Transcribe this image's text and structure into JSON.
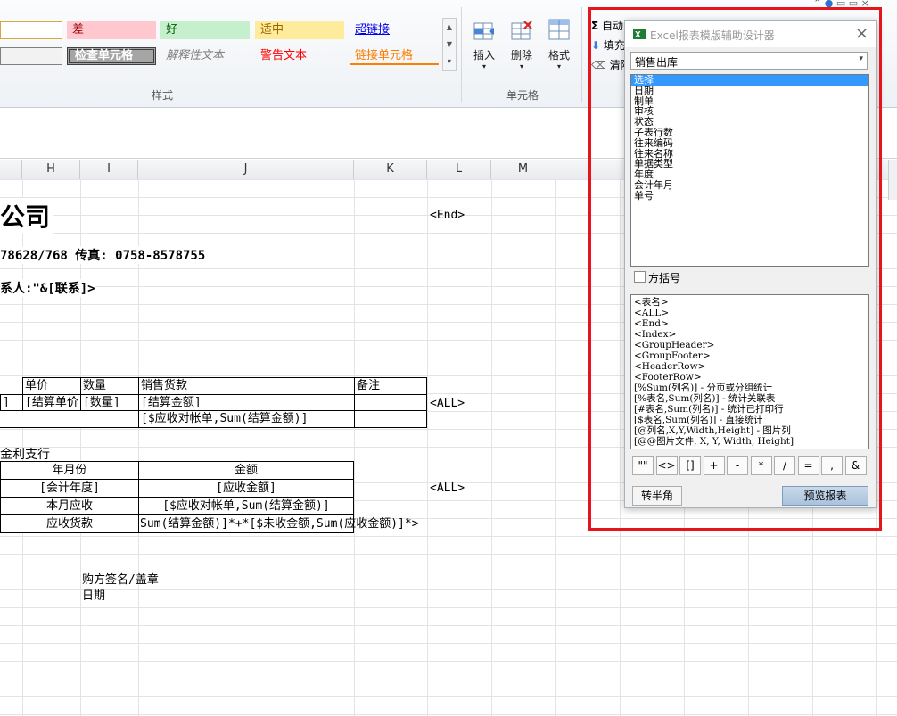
{
  "ribbon": {
    "styles": {
      "r1": [
        "差",
        "好",
        "适中",
        "超链接"
      ],
      "r2": [
        "检查单元格",
        "解释性文本",
        "警告文本",
        "链接单元格"
      ],
      "group_label": "样式"
    },
    "cells_group": {
      "insert": "插入",
      "delete": "删除",
      "format": "格式",
      "group_label": "单元格"
    },
    "editing": {
      "autosum": "自动",
      "fill": "填充",
      "clear": "清除"
    }
  },
  "columns": [
    "H",
    "I",
    "J",
    "K",
    "L",
    "M"
  ],
  "sheet": {
    "company": "公司",
    "end_tag": "<End>",
    "phone_line": "78628/768  传真: 0758-8578755",
    "contact_line": "系人:\"&[联系]>",
    "table1_headers": [
      "单价",
      "数量",
      "销售货款",
      "备注"
    ],
    "table1_row1": [
      "]",
      "[结算单价",
      "[数量]",
      "[结算金额]"
    ],
    "table1_row2": "[$应收对帐单,Sum(结算金额)]",
    "all_tag1": "<ALL>",
    "bank": "金利支行",
    "table2_headers": [
      "年月份",
      "金额"
    ],
    "table2_rows": [
      [
        "[会计年度]",
        "[应收金额]"
      ],
      [
        "本月应收",
        "[$应收对帐单,Sum(结算金额)]"
      ],
      [
        "应收货款",
        "Sum(结算金额)]*+*[$未收金额,Sum(应收金额)]*>"
      ]
    ],
    "all_tag2": "<ALL>",
    "buyer_sign": "购方签名/盖章",
    "date": "日期"
  },
  "dialog": {
    "title": "Excel报表模版辅助设计器",
    "dropdown_value": "销售出库",
    "field_list": [
      "选择",
      "日期",
      "制单",
      "审核",
      "状态",
      "子表行数",
      "往来编码",
      "往来名称",
      "单据类型",
      "年度",
      "会计年月",
      "单号"
    ],
    "bracket_checkbox": "方括号",
    "tag_list": [
      "<表名>",
      "<ALL>",
      "<End>",
      "<Index>",
      "<GroupHeader>",
      "<GroupFooter>",
      "<HeaderRow>",
      "<FooterRow>",
      "[%Sum(列名)] - 分页或分组统计",
      "[%表名,Sum(列名)] - 统计关联表",
      "[#表名,Sum(列名)] - 统计已打印行",
      "[$表名,Sum(列名)] - 直接统计",
      "[@列名,X,Y,Width,Height] - 图片列",
      "[@@图片文件, X, Y, Width, Height]"
    ],
    "symbols": [
      "\"\"",
      "<>",
      "[]",
      "+",
      "-",
      "*",
      "/",
      "=",
      ",",
      "&"
    ],
    "half_width_button": "转半角",
    "preview_button": "预览报表"
  },
  "colors": {
    "highlight_box": "#e8141b",
    "list_selection": "#3399ff"
  }
}
